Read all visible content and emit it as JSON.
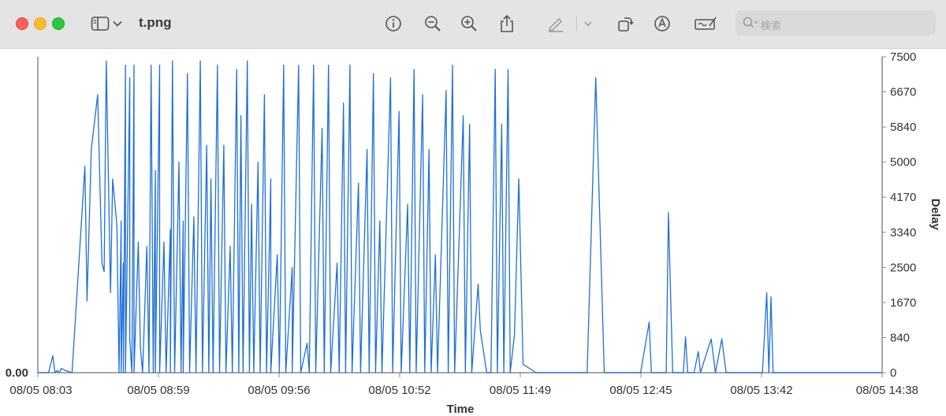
{
  "window": {
    "title": "t.png",
    "search_placeholder": "検索",
    "toolbar_icons": [
      "sidebar-icon",
      "chevron-down-icon",
      "info-icon",
      "zoom-out-icon",
      "zoom-in-icon",
      "share-icon",
      "markup-pen-icon",
      "chevron-down-icon",
      "rotate-icon",
      "annotate-icon",
      "signature-icon",
      "search-icon"
    ]
  },
  "chart_data": {
    "type": "line",
    "xlabel": "Time",
    "ylabel": "Delay",
    "left_axis_label": "0.00",
    "x_ticks": [
      "08/05 08:03",
      "08/05 08:59",
      "08/05 09:56",
      "08/05 10:52",
      "08/05 11:49",
      "08/05 12:45",
      "08/05 13:42",
      "08/05 14:38"
    ],
    "y_ticks": [
      "7500",
      "6670",
      "5840",
      "5000",
      "4170",
      "3340",
      "2500",
      "1670",
      "840",
      "0"
    ],
    "ylim": [
      0,
      7500
    ],
    "xlim": [
      "08:03",
      "14:38"
    ],
    "line_color": "#1f6fd6",
    "series": [
      {
        "values": [
          [
            "08:03",
            0
          ],
          [
            "08:05",
            0
          ],
          [
            "08:08",
            0
          ],
          [
            "08:10",
            400
          ],
          [
            "08:11",
            0
          ],
          [
            "08:12",
            50
          ],
          [
            "08:13",
            0
          ],
          [
            "08:14",
            100
          ],
          [
            "08:16",
            50
          ],
          [
            "08:19",
            0
          ],
          [
            "08:25",
            4900
          ],
          [
            "08:26",
            1700
          ],
          [
            "08:28",
            5300
          ],
          [
            "08:31",
            6600
          ],
          [
            "08:33",
            2600
          ],
          [
            "08:34",
            2400
          ],
          [
            "08:35",
            7400
          ],
          [
            "08:37",
            1900
          ],
          [
            "08:38",
            4600
          ],
          [
            "08:40",
            3500
          ],
          [
            "08:41",
            0
          ],
          [
            "08:42",
            3600
          ],
          [
            "08:42",
            0
          ],
          [
            "08:43",
            2600
          ],
          [
            "08:43",
            0
          ],
          [
            "08:44",
            7300
          ],
          [
            "08:44",
            0
          ],
          [
            "08:46",
            7000
          ],
          [
            "08:46",
            800
          ],
          [
            "08:47",
            0
          ],
          [
            "08:48",
            7300
          ],
          [
            "08:48",
            0
          ],
          [
            "08:50",
            3100
          ],
          [
            "08:51",
            600
          ],
          [
            "08:52",
            0
          ],
          [
            "08:54",
            3000
          ],
          [
            "08:55",
            0
          ],
          [
            "08:56",
            7300
          ],
          [
            "08:57",
            0
          ],
          [
            "08:58",
            4800
          ],
          [
            "08:58",
            0
          ],
          [
            "09:00",
            7300
          ],
          [
            "09:00",
            0
          ],
          [
            "09:02",
            3100
          ],
          [
            "09:03",
            0
          ],
          [
            "09:05",
            3400
          ],
          [
            "09:05",
            0
          ],
          [
            "09:06",
            7400
          ],
          [
            "09:07",
            0
          ],
          [
            "09:09",
            5000
          ],
          [
            "09:10",
            0
          ],
          [
            "09:11",
            3600
          ],
          [
            "09:11",
            0
          ],
          [
            "09:13",
            7100
          ],
          [
            "09:14",
            0
          ],
          [
            "09:16",
            3700
          ],
          [
            "09:17",
            0
          ],
          [
            "09:19",
            7400
          ],
          [
            "09:20",
            0
          ],
          [
            "09:22",
            5400
          ],
          [
            "09:23",
            0
          ],
          [
            "09:24",
            4600
          ],
          [
            "09:25",
            0
          ],
          [
            "09:27",
            7300
          ],
          [
            "09:28",
            0
          ],
          [
            "09:30",
            5400
          ],
          [
            "09:31",
            0
          ],
          [
            "09:33",
            3000
          ],
          [
            "09:34",
            0
          ],
          [
            "09:36",
            7200
          ],
          [
            "09:37",
            0
          ],
          [
            "09:38",
            6100
          ],
          [
            "09:39",
            0
          ],
          [
            "09:41",
            7400
          ],
          [
            "09:42",
            0
          ],
          [
            "09:43",
            4000
          ],
          [
            "09:44",
            0
          ],
          [
            "09:46",
            5000
          ],
          [
            "09:47",
            0
          ],
          [
            "09:49",
            6600
          ],
          [
            "09:50",
            0
          ],
          [
            "09:52",
            4600
          ],
          [
            "09:52",
            0
          ],
          [
            "09:55",
            2800
          ],
          [
            "09:56",
            0
          ],
          [
            "09:58",
            7300
          ],
          [
            "09:59",
            0
          ],
          [
            "10:02",
            2500
          ],
          [
            "10:02",
            0
          ],
          [
            "10:05",
            7300
          ],
          [
            "10:06",
            0
          ],
          [
            "10:09",
            700
          ],
          [
            "10:10",
            0
          ],
          [
            "10:12",
            7300
          ],
          [
            "10:13",
            0
          ],
          [
            "10:16",
            5800
          ],
          [
            "10:17",
            0
          ],
          [
            "10:19",
            7300
          ],
          [
            "10:20",
            0
          ],
          [
            "10:23",
            2600
          ],
          [
            "10:24",
            0
          ],
          [
            "10:26",
            6400
          ],
          [
            "10:27",
            0
          ],
          [
            "10:29",
            7300
          ],
          [
            "10:30",
            0
          ],
          [
            "10:33",
            4500
          ],
          [
            "10:34",
            0
          ],
          [
            "10:37",
            5300
          ],
          [
            "10:38",
            0
          ],
          [
            "10:40",
            7100
          ],
          [
            "10:41",
            0
          ],
          [
            "10:43",
            3600
          ],
          [
            "10:44",
            0
          ],
          [
            "10:48",
            7000
          ],
          [
            "10:49",
            0
          ],
          [
            "10:52",
            6200
          ],
          [
            "10:53",
            0
          ],
          [
            "10:56",
            4000
          ],
          [
            "10:57",
            0
          ],
          [
            "10:59",
            7200
          ],
          [
            "11:00",
            0
          ],
          [
            "11:03",
            6600
          ],
          [
            "11:04",
            0
          ],
          [
            "11:06",
            5300
          ],
          [
            "11:07",
            0
          ],
          [
            "11:09",
            2800
          ],
          [
            "11:10",
            0
          ],
          [
            "11:14",
            6700
          ],
          [
            "11:15",
            0
          ],
          [
            "11:17",
            7300
          ],
          [
            "11:18",
            0
          ],
          [
            "11:22",
            6100
          ],
          [
            "11:23",
            0
          ],
          [
            "11:25",
            5900
          ],
          [
            "11:26",
            0
          ],
          [
            "11:29",
            2100
          ],
          [
            "11:30",
            1000
          ],
          [
            "11:33",
            0
          ],
          [
            "11:35",
            0
          ],
          [
            "11:37",
            7200
          ],
          [
            "11:38",
            0
          ],
          [
            "11:40",
            5900
          ],
          [
            "11:41",
            0
          ],
          [
            "11:43",
            7200
          ],
          [
            "11:44",
            0
          ],
          [
            "11:46",
            900
          ],
          [
            "11:48",
            4600
          ],
          [
            "11:50",
            200
          ],
          [
            "11:56",
            0
          ],
          [
            "12:20",
            0
          ],
          [
            "12:24",
            7000
          ],
          [
            "12:28",
            0
          ],
          [
            "12:45",
            0
          ],
          [
            "12:49",
            1200
          ],
          [
            "12:50",
            0
          ],
          [
            "12:57",
            0
          ],
          [
            "12:58",
            3800
          ],
          [
            "13:00",
            0
          ],
          [
            "13:05",
            0
          ],
          [
            "13:06",
            850
          ],
          [
            "13:07",
            0
          ],
          [
            "13:10",
            0
          ],
          [
            "13:12",
            500
          ],
          [
            "13:13",
            0
          ],
          [
            "13:18",
            800
          ],
          [
            "13:20",
            0
          ],
          [
            "13:23",
            800
          ],
          [
            "13:25",
            0
          ],
          [
            "13:35",
            0
          ],
          [
            "13:42",
            0
          ],
          [
            "13:44",
            1900
          ],
          [
            "13:45",
            0
          ],
          [
            "13:46",
            1800
          ],
          [
            "13:47",
            0
          ],
          [
            "14:00",
            0
          ],
          [
            "14:38",
            0
          ]
        ]
      }
    ]
  }
}
